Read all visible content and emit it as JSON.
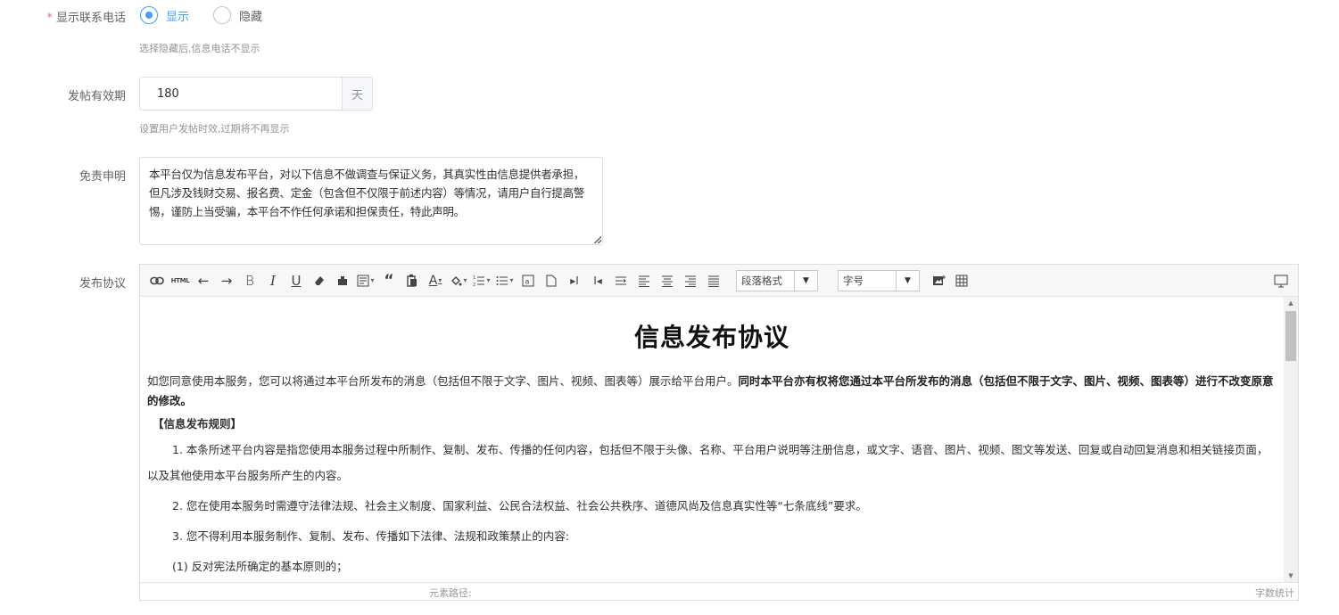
{
  "phone_display": {
    "label": "显示联系电话",
    "required_mark": "*",
    "options": [
      {
        "label": "显示",
        "checked": true
      },
      {
        "label": "隐藏",
        "checked": false
      }
    ],
    "hint": "选择隐藏后,信息电话不显示"
  },
  "post_validity": {
    "label": "发帖有效期",
    "value": "180",
    "unit": "天",
    "hint": "设置用户发帖时效,过期将不再显示"
  },
  "disclaimer": {
    "label": "免责申明",
    "value": "本平台仅为信息发布平台，对以下信息不做调查与保证义务，其真实性由信息提供者承担，但凡涉及钱财交易、报名费、定金（包含但不仅限于前述内容）等情况，请用户自行提高警惕，谨防上当受骗，本平台不作任何承诺和担保责任，特此声明。"
  },
  "agreement": {
    "label": "发布协议",
    "toolbar": {
      "paragraph_select": "段落格式",
      "font_size_select": "字号"
    },
    "doc": {
      "title": "信息发布协议",
      "intro_plain": "如您同意使用本服务，您可以将通过本平台所发布的消息（包括但不限于文字、图片、视频、图表等）展示给平台用户。",
      "intro_bold": "同时本平台亦有权将您通过本平台所发布的消息（包括但不限于文字、图片、视频、图表等）进行不改变原意的修改。",
      "rule_heading": "【信息发布规则】",
      "paragraphs": [
        "1. 本条所述平台内容是指您使用本服务过程中所制作、复制、发布、传播的任何内容，包括但不限于头像、名称、平台用户说明等注册信息，或文字、语音、图片、视频、图文等发送、回复或自动回复消息和相关链接页面，以及其他使用本平台服务所产生的内容。",
        "2. 您在使用本服务时需遵守法律法规、社会主义制度、国家利益、公民合法权益、社会公共秩序、道德风尚及信息真实性等“七条底线”要求。",
        "3. 您不得利用本服务制作、复制、发布、传播如下法律、法规和政策禁止的内容:",
        "(1) 反对宪法所确定的基本原则的；"
      ]
    },
    "status": {
      "path_label": "元素路径:",
      "word_count_label": "字数统计"
    }
  }
}
